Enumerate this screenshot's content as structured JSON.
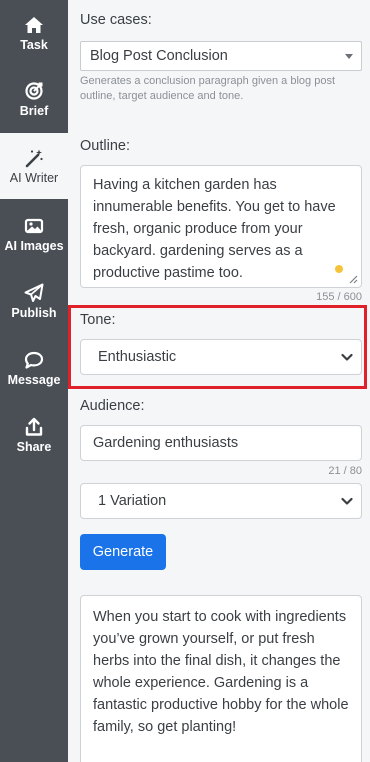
{
  "sidebar": {
    "items": [
      {
        "label": "Task",
        "icon": "home-icon"
      },
      {
        "label": "Brief",
        "icon": "target-icon"
      },
      {
        "label": "AI Writer",
        "icon": "magic-wand-icon",
        "active": true
      },
      {
        "label": "AI Images",
        "icon": "image-icon"
      },
      {
        "label": "Publish",
        "icon": "paper-plane-icon"
      },
      {
        "label": "Message",
        "icon": "chat-bubble-icon"
      },
      {
        "label": "Share",
        "icon": "share-upload-icon"
      }
    ]
  },
  "form": {
    "use_cases": {
      "label": "Use cases:",
      "selected": "Blog Post Conclusion",
      "hint": "Generates a conclusion paragraph given a blog post outline, target audience and tone."
    },
    "outline": {
      "label": "Outline:",
      "value": "Having a kitchen garden has innumerable benefits. You get to have fresh, organic produce from your backyard. gardening serves as a productive pastime too.",
      "counter": "155 / 600"
    },
    "tone": {
      "label": "Tone:",
      "selected": "Enthusiastic"
    },
    "audience": {
      "label": "Audience:",
      "value": "Gardening enthusiasts",
      "counter": "21 / 80"
    },
    "variations": {
      "selected": "1 Variation"
    },
    "generate_label": "Generate"
  },
  "output": {
    "text": "When you start to cook with ingredients you’ve grown yourself, or put fresh herbs into the final dish, it changes the whole experience. Gardening is a fantastic productive hobby for the whole family, so get planting!"
  },
  "colors": {
    "sidebar_bg": "#4a4f56",
    "primary": "#1a73e8",
    "highlight": "#e0212a",
    "status_dot": "#f5c33b"
  }
}
